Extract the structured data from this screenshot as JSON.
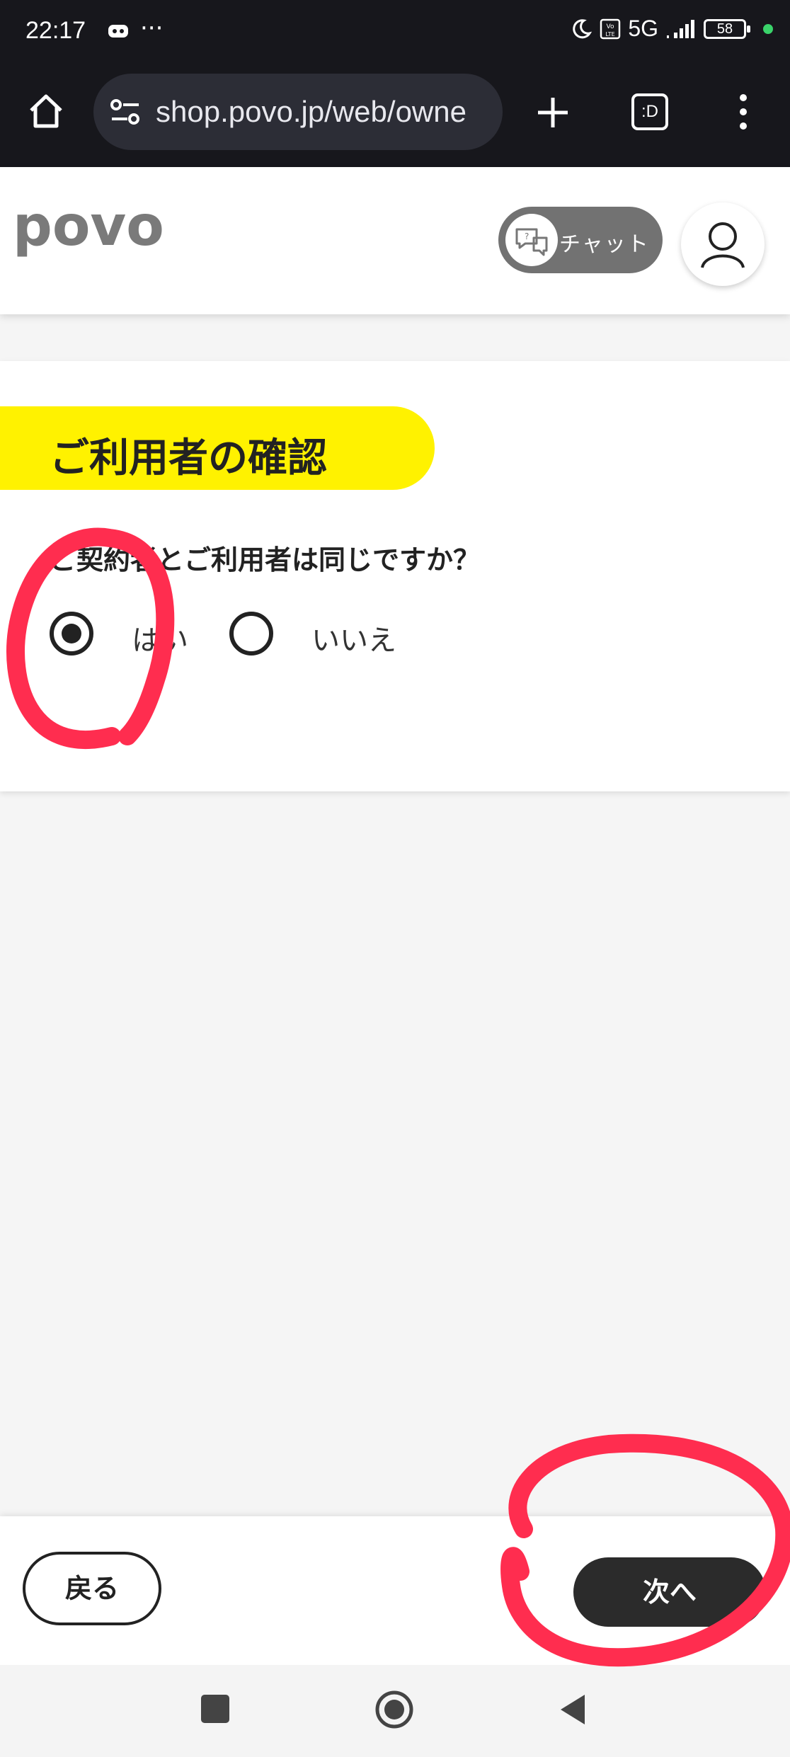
{
  "status_bar": {
    "time": "22:17",
    "more": "···",
    "network": "5G",
    "battery": "58"
  },
  "browser": {
    "url": "shop.povo.jp/web/owne",
    "tab_icon_text": ":D"
  },
  "header": {
    "logo_text": "povo",
    "chat_label": "チャット"
  },
  "section": {
    "title": "ご利用者の確認",
    "question": "ご契約者とご利用者は同じですか？",
    "options": [
      {
        "label": "はい",
        "selected": true
      },
      {
        "label": "いいえ",
        "selected": false
      }
    ]
  },
  "footer": {
    "back_label": "戻る",
    "next_label": "次へ"
  },
  "colors": {
    "accent_yellow": "#fff200",
    "annotation_red": "#ff2d4f",
    "dark": "#2b2b2b"
  }
}
